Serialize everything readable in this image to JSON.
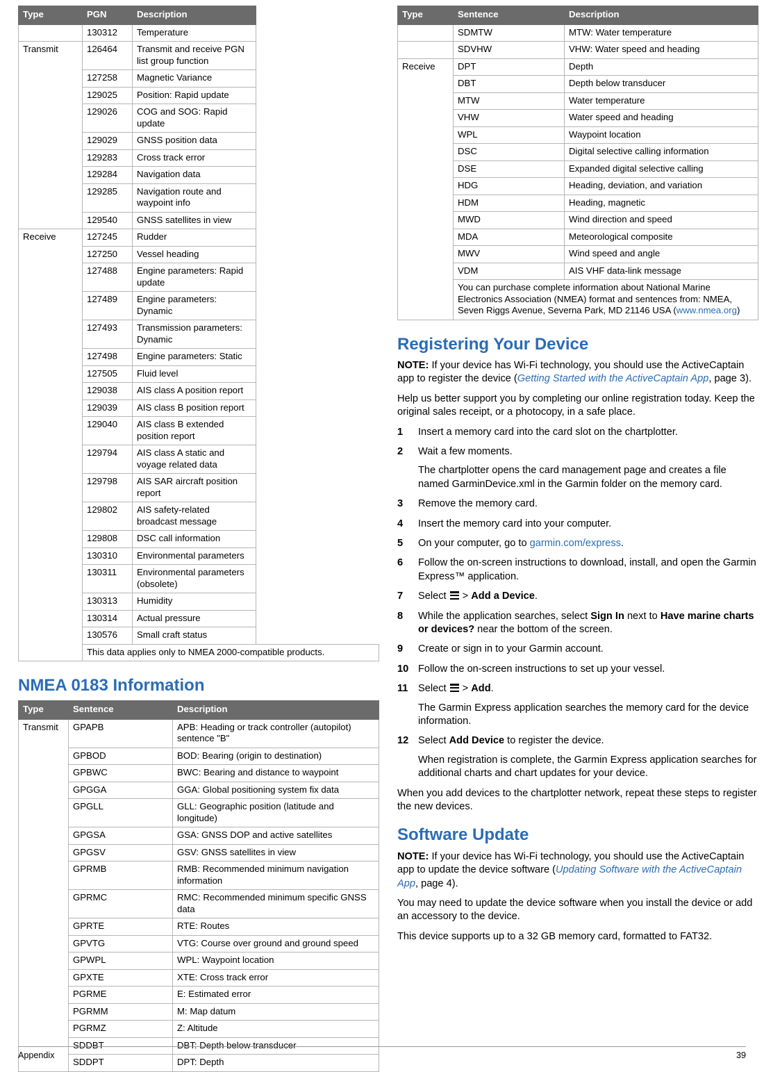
{
  "left": {
    "pgn_table": {
      "headers": [
        "Type",
        "PGN",
        "Description"
      ],
      "rows": [
        {
          "type": "",
          "pgn": "130312",
          "desc": "Temperature"
        },
        {
          "type": "Transmit",
          "pgn": "126464",
          "desc": "Transmit and receive PGN list group function",
          "rowspan": 9
        },
        {
          "type": "",
          "pgn": "127258",
          "desc": "Magnetic Variance"
        },
        {
          "type": "",
          "pgn": "129025",
          "desc": "Position: Rapid update"
        },
        {
          "type": "",
          "pgn": "129026",
          "desc": "COG and SOG: Rapid update"
        },
        {
          "type": "",
          "pgn": "129029",
          "desc": "GNSS position data"
        },
        {
          "type": "",
          "pgn": "129283",
          "desc": "Cross track error"
        },
        {
          "type": "",
          "pgn": "129284",
          "desc": "Navigation data"
        },
        {
          "type": "",
          "pgn": "129285",
          "desc": "Navigation route and waypoint info"
        },
        {
          "type": "",
          "pgn": "129540",
          "desc": "GNSS satellites in view"
        },
        {
          "type": "Receive",
          "pgn": "127245",
          "desc": "Rudder",
          "rowspan": 21
        },
        {
          "type": "",
          "pgn": "127250",
          "desc": "Vessel heading"
        },
        {
          "type": "",
          "pgn": "127488",
          "desc": "Engine parameters: Rapid update"
        },
        {
          "type": "",
          "pgn": "127489",
          "desc": "Engine parameters: Dynamic"
        },
        {
          "type": "",
          "pgn": "127493",
          "desc": "Transmission parameters: Dynamic"
        },
        {
          "type": "",
          "pgn": "127498",
          "desc": "Engine parameters: Static"
        },
        {
          "type": "",
          "pgn": "127505",
          "desc": "Fluid level"
        },
        {
          "type": "",
          "pgn": "129038",
          "desc": "AIS class A position report"
        },
        {
          "type": "",
          "pgn": "129039",
          "desc": "AIS class B position report"
        },
        {
          "type": "",
          "pgn": "129040",
          "desc": "AIS class B extended position report"
        },
        {
          "type": "",
          "pgn": "129794",
          "desc": "AIS class A static and voyage related data"
        },
        {
          "type": "",
          "pgn": "129798",
          "desc": "AIS SAR aircraft position report"
        },
        {
          "type": "",
          "pgn": "129802",
          "desc": "AIS safety-related broadcast message"
        },
        {
          "type": "",
          "pgn": "129808",
          "desc": "DSC call information"
        },
        {
          "type": "",
          "pgn": "130310",
          "desc": "Environmental parameters"
        },
        {
          "type": "",
          "pgn": "130311",
          "desc": "Environmental parameters (obsolete)"
        },
        {
          "type": "",
          "pgn": "130313",
          "desc": "Humidity"
        },
        {
          "type": "",
          "pgn": "130314",
          "desc": "Actual pressure"
        },
        {
          "type": "",
          "pgn": "130576",
          "desc": "Small craft status"
        }
      ],
      "footnote": "This data applies only to NMEA 2000-compatible products."
    },
    "nmea0183_heading": "NMEA 0183 Information",
    "n83_table": {
      "headers": [
        "Type",
        "Sentence",
        "Description"
      ],
      "rows": [
        {
          "type": "Transmit",
          "sentence": "GPAPB",
          "desc": "APB: Heading or track controller (autopilot) sentence \"B\"",
          "rowspan": 22
        },
        {
          "type": "",
          "sentence": "GPBOD",
          "desc": "BOD: Bearing (origin to destination)"
        },
        {
          "type": "",
          "sentence": "GPBWC",
          "desc": "BWC: Bearing and distance to waypoint"
        },
        {
          "type": "",
          "sentence": "GPGGA",
          "desc": "GGA: Global positioning system fix data"
        },
        {
          "type": "",
          "sentence": "GPGLL",
          "desc": "GLL: Geographic position (latitude and longitude)"
        },
        {
          "type": "",
          "sentence": "GPGSA",
          "desc": "GSA: GNSS DOP and active satellites"
        },
        {
          "type": "",
          "sentence": "GPGSV",
          "desc": "GSV: GNSS satellites in view"
        },
        {
          "type": "",
          "sentence": "GPRMB",
          "desc": "RMB: Recommended minimum navigation information"
        },
        {
          "type": "",
          "sentence": "GPRMC",
          "desc": "RMC: Recommended minimum specific GNSS data"
        },
        {
          "type": "",
          "sentence": "GPRTE",
          "desc": "RTE: Routes"
        },
        {
          "type": "",
          "sentence": "GPVTG",
          "desc": "VTG: Course over ground and ground speed"
        },
        {
          "type": "",
          "sentence": "GPWPL",
          "desc": "WPL: Waypoint location"
        },
        {
          "type": "",
          "sentence": "GPXTE",
          "desc": "XTE: Cross track error"
        },
        {
          "type": "",
          "sentence": "PGRME",
          "desc": "E: Estimated error"
        },
        {
          "type": "",
          "sentence": "PGRMM",
          "desc": "M: Map datum"
        },
        {
          "type": "",
          "sentence": "PGRMZ",
          "desc": "Z: Altitude"
        },
        {
          "type": "",
          "sentence": "SDDBT",
          "desc": "DBT: Depth below transducer"
        },
        {
          "type": "",
          "sentence": "SDDPT",
          "desc": "DPT: Depth"
        }
      ]
    }
  },
  "right": {
    "cont_table": {
      "headers": [
        "Type",
        "Sentence",
        "Description"
      ],
      "rows": [
        {
          "type": "",
          "sentence": "SDMTW",
          "desc": "MTW: Water temperature"
        },
        {
          "type": "",
          "sentence": "SDVHW",
          "desc": "VHW: Water speed and heading"
        },
        {
          "type": "Receive",
          "sentence": "DPT",
          "desc": "Depth",
          "rowspan": 13
        },
        {
          "type": "",
          "sentence": "DBT",
          "desc": "Depth below transducer"
        },
        {
          "type": "",
          "sentence": "MTW",
          "desc": "Water temperature"
        },
        {
          "type": "",
          "sentence": "VHW",
          "desc": "Water speed and heading"
        },
        {
          "type": "",
          "sentence": "WPL",
          "desc": "Waypoint location"
        },
        {
          "type": "",
          "sentence": "DSC",
          "desc": "Digital selective calling information"
        },
        {
          "type": "",
          "sentence": "DSE",
          "desc": "Expanded digital selective calling"
        },
        {
          "type": "",
          "sentence": "HDG",
          "desc": "Heading, deviation, and variation"
        },
        {
          "type": "",
          "sentence": "HDM",
          "desc": "Heading, magnetic"
        },
        {
          "type": "",
          "sentence": "MWD",
          "desc": "Wind direction and speed"
        },
        {
          "type": "",
          "sentence": "MDA",
          "desc": "Meteorological composite"
        },
        {
          "type": "",
          "sentence": "MWV",
          "desc": "Wind speed and angle"
        },
        {
          "type": "",
          "sentence": "VDM",
          "desc": "AIS VHF data-link message"
        }
      ],
      "footnote_pre": "You can purchase complete information about National Marine Electronics Association (NMEA) format and sentences from: NMEA, Seven Riggs Avenue, Severna Park, MD 21146 USA (",
      "footnote_link": "www.nmea.org",
      "footnote_post": ")"
    },
    "registering": {
      "heading": "Registering Your Device",
      "note_label": "NOTE:",
      "note_text_1": " If your device has Wi‑Fi technology, you should use the ActiveCaptain app to register the device (",
      "note_ref": "Getting Started with the ActiveCaptain App",
      "note_text_2": ", page 3).",
      "paragraph": "Help us better support you by completing our online registration today. Keep the original sales receipt, or a photocopy, in a safe place.",
      "steps": [
        {
          "num": "1",
          "text": "Insert a memory card into the card slot on the chartplotter."
        },
        {
          "num": "2",
          "text": "Wait a few moments.",
          "sub": "The chartplotter opens the card management page and creates a file named GarminDevice.xml in the Garmin folder on the memory card."
        },
        {
          "num": "3",
          "text": "Remove the memory card."
        },
        {
          "num": "4",
          "text": "Insert the memory card into your computer."
        },
        {
          "num": "5",
          "text": "On your computer, go to ",
          "link": "garmin.com/express",
          "text_after": "."
        },
        {
          "num": "6",
          "text": "Follow the on-screen instructions to download, install, and open the Garmin Express™ application."
        },
        {
          "num": "7",
          "text_pre": "Select ",
          "icon": "menu-icon",
          "text_mid": " > ",
          "bold": "Add a Device",
          "text_after": "."
        },
        {
          "num": "8",
          "text_pre": "While the application searches, select ",
          "bold": "Sign In",
          "text_mid2": " next to ",
          "bold2": "Have marine charts or devices?",
          "text_after": " near the bottom of the screen."
        },
        {
          "num": "9",
          "text": "Create or sign in to your Garmin account."
        },
        {
          "num": "10",
          "text": "Follow the on-screen instructions to set up your vessel."
        },
        {
          "num": "11",
          "text_pre": "Select ",
          "icon": "menu-icon",
          "text_mid": " > ",
          "bold": "Add",
          "text_after": ".",
          "sub": "The Garmin Express application searches the memory card for the device information."
        },
        {
          "num": "12",
          "text_pre": "Select ",
          "bold": "Add Device",
          "text_after": " to register the device.",
          "sub": "When registration is complete, the Garmin Express application searches for additional charts and chart updates for your device."
        }
      ],
      "closing": "When you add devices to the chartplotter network, repeat these steps to register the new devices."
    },
    "software_update": {
      "heading": "Software Update",
      "note_label": "NOTE:",
      "note_text_1": " If your device has Wi‑Fi technology, you should use the ActiveCaptain app to update the device software (",
      "note_ref": "Updating Software with the ActiveCaptain App",
      "note_text_2": ", page 4).",
      "paragraph_1": "You may need to update the device software when you install the device or add an accessory to the device.",
      "paragraph_2": "This device supports up to a 32 GB memory card, formatted to FAT32."
    }
  },
  "footer": {
    "left": "Appendix",
    "right": "39"
  },
  "colors": {
    "accent": "#2b6cb5",
    "header_bg": "#6b6b6b",
    "border": "#b5b5b5"
  }
}
